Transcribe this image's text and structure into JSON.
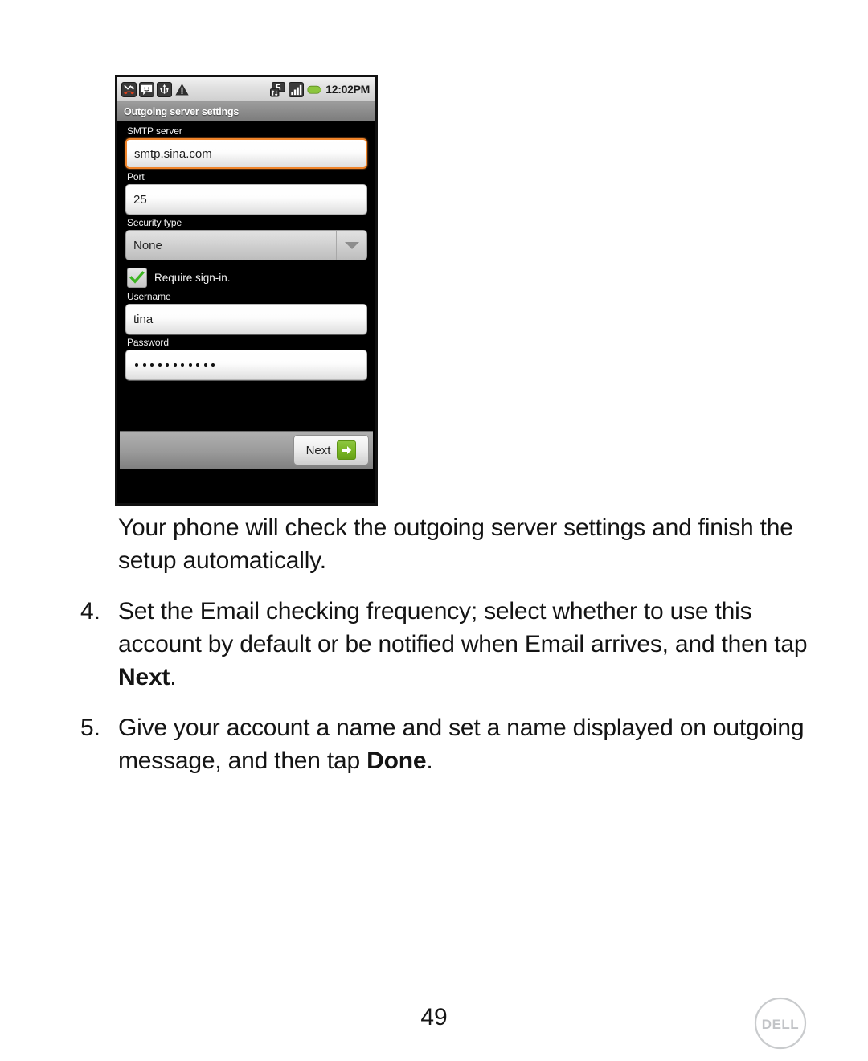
{
  "phone": {
    "status_bar": {
      "icons_left": [
        "missed-call-icon",
        "message-icon",
        "usb-icon",
        "warning-icon"
      ],
      "icons_right": [
        "edge-data-icon",
        "signal-bars-icon",
        "battery-icon"
      ],
      "clock": "12:02PM"
    },
    "title": "Outgoing server settings",
    "fields": {
      "smtp_label": "SMTP server",
      "smtp_value": "smtp.sina.com",
      "port_label": "Port",
      "port_value": "25",
      "security_label": "Security type",
      "security_value": "None",
      "require_signin_label": "Require sign-in.",
      "require_signin_checked": true,
      "username_label": "Username",
      "username_value": "tina",
      "password_label": "Password",
      "password_dots": 11
    },
    "next_button_label": "Next",
    "accent_focus_color": "#f0842a",
    "accent_green_color": "#76b321"
  },
  "document": {
    "intro_paragraph": "Your phone will check the outgoing server settings and finish the setup automatically.",
    "steps": [
      {
        "number": "4.",
        "text_before": "Set the Email checking frequency; select whether to use this account by default or be notified when Email arrives, and then tap ",
        "bold": "Next",
        "text_after": "."
      },
      {
        "number": "5.",
        "text_before": "Give your account a name and set a name displayed on outgoing message, and then tap ",
        "bold": "Done",
        "text_after": "."
      }
    ],
    "page_number": "49",
    "brand": "DELL"
  }
}
